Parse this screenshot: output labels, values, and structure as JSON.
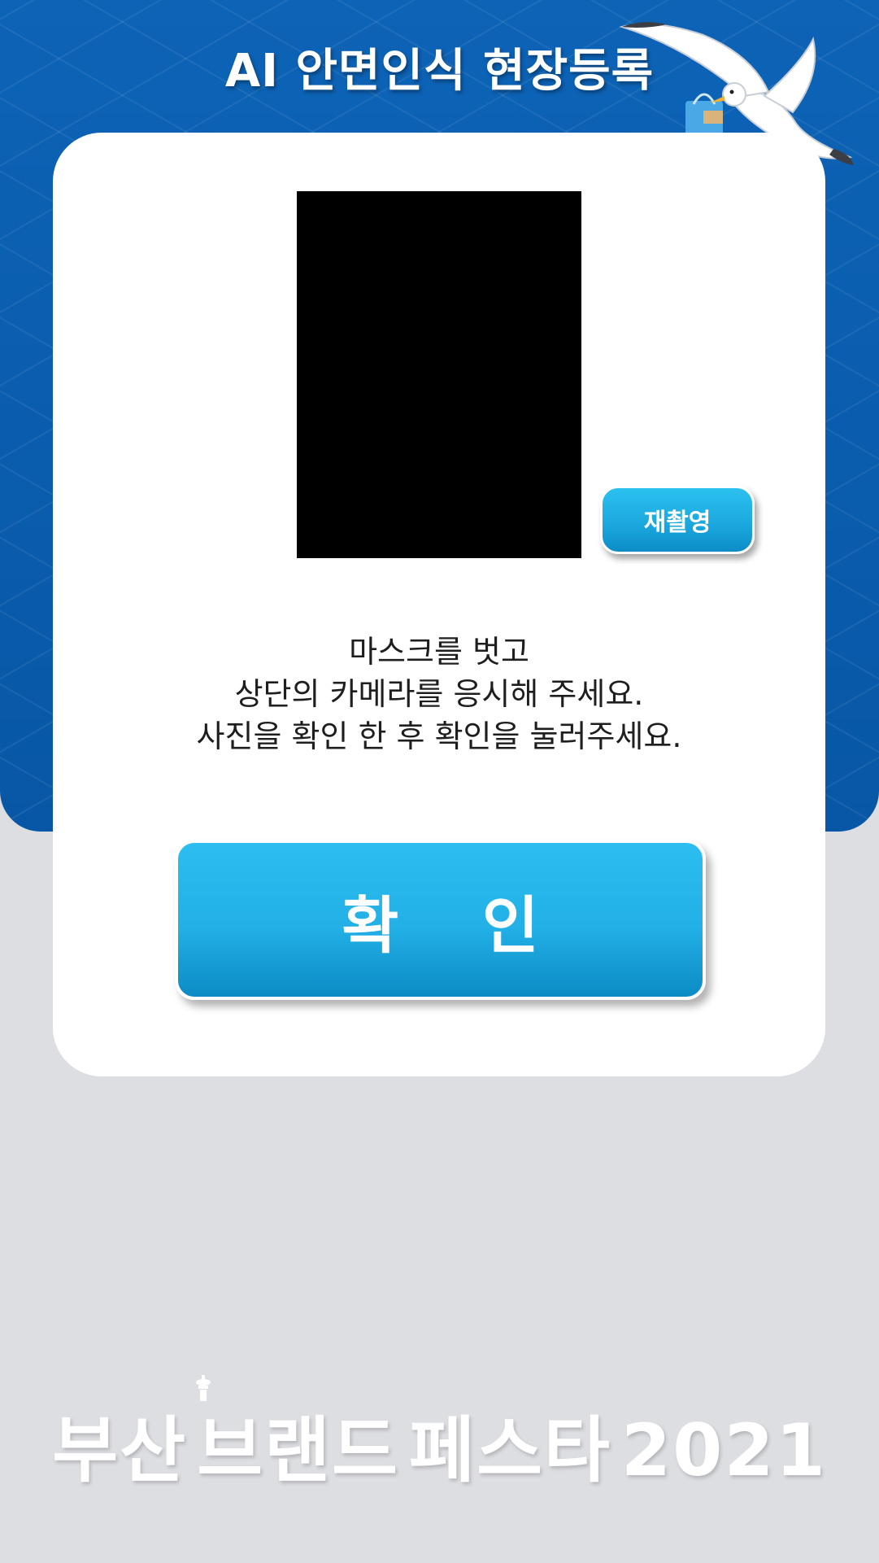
{
  "header": {
    "title": "AI 안면인식 현장등록"
  },
  "camera": {
    "retake_label": "재촬영"
  },
  "instructions": {
    "lines": [
      "마스크를 벗고",
      "상단의 카메라를 응시해 주세요.",
      "사진을 확인 한 후 확인을 눌러주세요."
    ]
  },
  "confirm": {
    "label": "확 인"
  },
  "footer": {
    "logo_words": [
      "부산",
      "브랜드",
      "페스타",
      "2021"
    ]
  },
  "colors": {
    "header_blue": "#0a5fb0",
    "button_blue": "#22b0e6",
    "background_gray": "#dddee2"
  },
  "icons": [
    "seagull-icon",
    "tower-icon"
  ]
}
